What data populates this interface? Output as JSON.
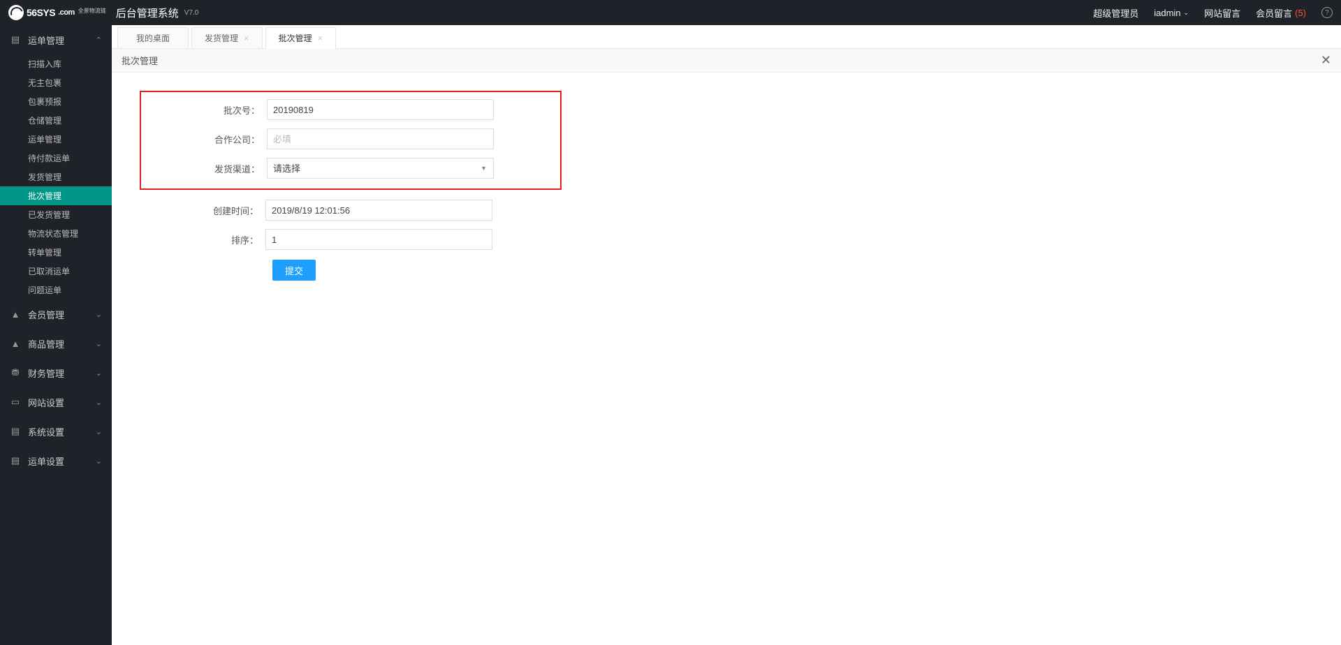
{
  "header": {
    "logo_main": "56SYS",
    "logo_domain": ".com",
    "logo_sub": "全景物流链",
    "system_title": "后台管理系统",
    "version": "V7.0",
    "role_label": "超级管理员",
    "username": "iadmin",
    "site_msg": "网站留言",
    "member_msg": "会员留言",
    "member_msg_count": "(5)"
  },
  "sidebar": {
    "groups": [
      {
        "label": "运单管理",
        "icon": "▤",
        "expanded": true,
        "items": [
          "扫描入库",
          "无主包裹",
          "包裹预报",
          "仓储管理",
          "运单管理",
          "待付款运单",
          "发货管理",
          "批次管理",
          "已发货管理",
          "物流状态管理",
          "转单管理",
          "已取消运单",
          "问题运单"
        ],
        "active_index": 7
      },
      {
        "label": "会员管理",
        "icon": "👤",
        "expanded": false
      },
      {
        "label": "商品管理",
        "icon": "👤",
        "expanded": false
      },
      {
        "label": "财务管理",
        "icon": "⛁",
        "expanded": false
      },
      {
        "label": "网站设置",
        "icon": "▭",
        "expanded": false
      },
      {
        "label": "系统设置",
        "icon": "▤",
        "expanded": false
      },
      {
        "label": "运单设置",
        "icon": "▤",
        "expanded": false
      }
    ]
  },
  "tabs": [
    {
      "label": "我的桌面",
      "closable": false,
      "active": false
    },
    {
      "label": "发货管理",
      "closable": true,
      "active": false
    },
    {
      "label": "批次管理",
      "closable": true,
      "active": true
    }
  ],
  "page": {
    "title": "批次管理"
  },
  "form": {
    "batch_no_label": "批次号：",
    "batch_no_value": "20190819",
    "partner_label": "合作公司：",
    "partner_placeholder": "必填",
    "channel_label": "发货渠道：",
    "channel_value": "请选择",
    "create_time_label": "创建时间：",
    "create_time_value": "2019/8/19 12:01:56",
    "sort_label": "排序：",
    "sort_value": "1",
    "submit_label": "提交"
  }
}
